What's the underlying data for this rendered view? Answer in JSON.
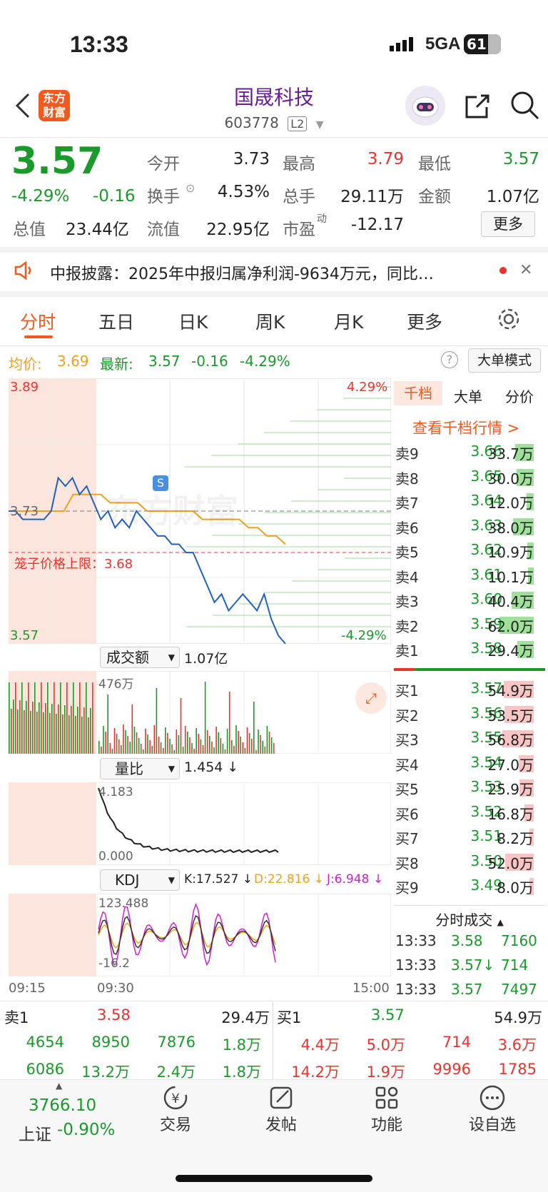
{
  "status_bar": {
    "time": "13:33",
    "network": "5GA",
    "battery": "61"
  },
  "nav": {
    "logo_line1": "东方",
    "logo_line2": "财富",
    "stock_name": "国晟科技",
    "stock_code": "603778",
    "level_badge": "L2"
  },
  "quote": {
    "price": "3.57",
    "change_pct": "-4.29%",
    "change": "-0.16",
    "open_label": "今开",
    "open": "3.73",
    "high_label": "最高",
    "high": "3.79",
    "low_label": "最低",
    "low": "3.57",
    "turnover_label": "换手",
    "turnover": "4.53%",
    "volume_label": "总手",
    "volume": "29.11万",
    "amount_label": "金额",
    "amount": "1.07亿",
    "mktcap_label": "总值",
    "mktcap": "23.44亿",
    "float_label": "流值",
    "float_cap": "22.95亿",
    "pe_label": "市盈",
    "pe_sup": "动",
    "pe": "-12.17",
    "more_button": "更多"
  },
  "notice": {
    "text": "中报披露：2025年中报归属净利润-9634万元，同比…"
  },
  "tabs": [
    "分时",
    "五日",
    "日K",
    "周K",
    "月K",
    "更多"
  ],
  "chart_header": {
    "avg_label": "均价:",
    "avg": "3.69",
    "last_label": "最新:",
    "last": "3.57",
    "chg": "-0.16",
    "chg_pct": "-4.29%",
    "mode_button": "大单模式"
  },
  "chart_labels": {
    "top_price": "3.89",
    "top_pct": "4.29%",
    "mid_price": "3.73",
    "bottom_price": "3.57",
    "bottom_pct": "-4.29%",
    "cage_label": "笼子价格上限：3.68",
    "watermark": "东方财富",
    "vol_select": "成交额",
    "vol_total": "1.07亿",
    "vol_max": "476万",
    "ratio_select": "量比",
    "ratio_val": "1.454 ↓",
    "ratio_max": "4.183",
    "ratio_min": "0.000",
    "kdj_select": "KDJ",
    "k": "K:17.527 ↓",
    "d": "D:22.816 ↓",
    "j": "J:6.948 ↓",
    "kdj_max": "123.488",
    "kdj_min": "-16.2",
    "t_start": "09:15",
    "t_open": "09:30",
    "t_end": "15:00"
  },
  "colors": {
    "up": "#e8332e",
    "down": "#1a9a2a",
    "price_line": "#2060c0",
    "avg_line": "#f0a020",
    "accent": "#ee5a1f"
  },
  "chart_data": {
    "type": "line",
    "series": [
      {
        "name": "最新",
        "values": [
          3.73,
          3.73,
          3.72,
          3.72,
          3.72,
          3.72,
          3.73,
          3.77,
          3.76,
          3.77,
          3.75,
          3.76,
          3.74,
          3.72,
          3.73,
          3.71,
          3.72,
          3.71,
          3.73,
          3.72,
          3.71,
          3.7,
          3.7,
          3.69,
          3.69,
          3.68,
          3.68,
          3.66,
          3.64,
          3.62,
          3.63,
          3.61,
          3.62,
          3.63,
          3.62,
          3.61,
          3.63,
          3.6,
          3.58,
          3.57
        ]
      },
      {
        "name": "均价",
        "values": [
          3.73,
          3.73,
          3.73,
          3.73,
          3.73,
          3.73,
          3.73,
          3.75,
          3.75,
          3.75,
          3.75,
          3.74,
          3.74,
          3.74,
          3.74,
          3.73,
          3.73,
          3.73,
          3.73,
          3.73,
          3.73,
          3.72,
          3.72,
          3.72,
          3.72,
          3.72,
          3.71,
          3.71,
          3.7,
          3.7,
          3.69
        ]
      }
    ],
    "ylim": [
      3.57,
      3.89
    ]
  },
  "orderbook": {
    "tabs": [
      "千档",
      "大单",
      "分价"
    ],
    "link": "查看千档行情 >",
    "asks": [
      {
        "label": "卖9",
        "price": "3.66",
        "vol": "33.7万",
        "ratio": 0.55
      },
      {
        "label": "卖8",
        "price": "3.65",
        "vol": "30.0万",
        "ratio": 0.49
      },
      {
        "label": "卖7",
        "price": "3.64",
        "vol": "12.0万",
        "ratio": 0.2
      },
      {
        "label": "卖6",
        "price": "3.63",
        "vol": "38.0万",
        "ratio": 0.61
      },
      {
        "label": "卖5",
        "price": "3.62",
        "vol": "10.9万",
        "ratio": 0.18
      },
      {
        "label": "卖4",
        "price": "3.61",
        "vol": "10.1万",
        "ratio": 0.16
      },
      {
        "label": "卖3",
        "price": "3.60",
        "vol": "40.4万",
        "ratio": 0.65
      },
      {
        "label": "卖2",
        "price": "3.59",
        "vol": "62.0万",
        "ratio": 1.0
      },
      {
        "label": "卖1",
        "price": "3.58",
        "vol": "29.4万",
        "ratio": 0.47
      }
    ],
    "bids": [
      {
        "label": "买1",
        "price": "3.57",
        "vol": "54.9万",
        "ratio": 0.88
      },
      {
        "label": "买2",
        "price": "3.56",
        "vol": "53.5万",
        "ratio": 0.86
      },
      {
        "label": "买3",
        "price": "3.55",
        "vol": "56.8万",
        "ratio": 0.92
      },
      {
        "label": "买4",
        "price": "3.54",
        "vol": "27.0万",
        "ratio": 0.44
      },
      {
        "label": "买5",
        "price": "3.53",
        "vol": "25.9万",
        "ratio": 0.42
      },
      {
        "label": "买6",
        "price": "3.52",
        "vol": "16.8万",
        "ratio": 0.27
      },
      {
        "label": "买7",
        "price": "3.51",
        "vol": "8.2万",
        "ratio": 0.13
      },
      {
        "label": "买8",
        "price": "3.50",
        "vol": "52.0万",
        "ratio": 0.84
      },
      {
        "label": "买9",
        "price": "3.49",
        "vol": "8.0万",
        "ratio": 0.13
      }
    ],
    "ticks_title": "分时成交",
    "ticks": [
      {
        "time": "13:33",
        "price": "3.58",
        "vol": "7160"
      },
      {
        "time": "13:33",
        "price": "3.57↓",
        "vol": "714"
      },
      {
        "time": "13:33",
        "price": "3.57",
        "vol": "7497"
      }
    ]
  },
  "bottom_queue": {
    "ask_label": "卖1",
    "ask_price": "3.58",
    "ask_vol": "29.4万",
    "bid_label": "买1",
    "bid_price": "3.57",
    "bid_vol": "54.9万",
    "ask_row1": [
      "4654",
      "8950",
      "7876",
      "1.8万"
    ],
    "ask_row2": [
      "6086",
      "13.2万",
      "2.4万",
      "1.8万"
    ],
    "bid_row1": [
      "4.4万",
      "5.0万",
      "714",
      "3.6万"
    ],
    "bid_row2": [
      "14.2万",
      "1.9万",
      "9996",
      "1785"
    ]
  },
  "dock": {
    "index_value": "3766.10",
    "index_name": "上证",
    "index_chg": "-0.90%",
    "trade": "交易",
    "post": "发帖",
    "func": "功能",
    "watch": "设自选"
  }
}
